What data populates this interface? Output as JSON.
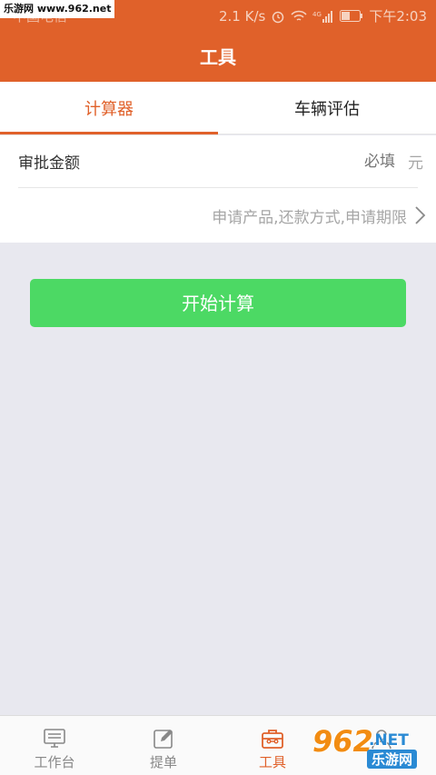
{
  "status_bar": {
    "carrier": "中国电信",
    "speed": "2.1 K/s",
    "time": "下午2:03",
    "network_label": "4G"
  },
  "watermark_top": "乐游网 www.962.net",
  "header": {
    "title": "工具"
  },
  "tabs": [
    {
      "label": "计算器",
      "active": true
    },
    {
      "label": "车辆评估",
      "active": false
    }
  ],
  "form": {
    "amount_label": "审批金额",
    "amount_placeholder": "必填",
    "amount_unit": "元",
    "options_text": "申请产品,还款方式,申请期限"
  },
  "start_button": "开始计算",
  "bottom_nav": [
    {
      "label": "工作台",
      "icon": "workbench-icon",
      "active": false
    },
    {
      "label": "提单",
      "icon": "edit-icon",
      "active": false
    },
    {
      "label": "工具",
      "icon": "toolbox-icon",
      "active": true
    },
    {
      "label": "",
      "icon": "user-icon",
      "active": false
    }
  ],
  "watermark_bottom": {
    "number": "962",
    "net": ".NET",
    "cn": "乐游网"
  },
  "colors": {
    "accent": "#e0612a",
    "button": "#4cd964",
    "background": "#e8e8ef"
  }
}
